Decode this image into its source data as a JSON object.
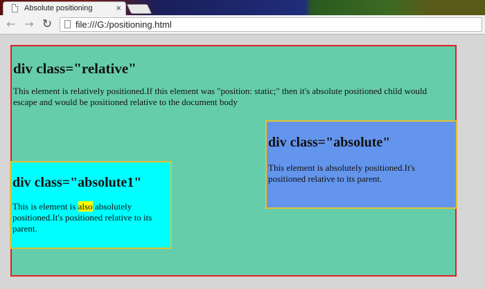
{
  "browser": {
    "tab_title": "Absolute positioning",
    "tab_close": "×",
    "url": "file:///G:/positioning.html",
    "back_icon": "back-arrow-icon",
    "forward_icon": "forward-arrow-icon",
    "reload_icon": "reload-icon"
  },
  "page": {
    "relative": {
      "heading": "div class=\"relative\"",
      "text": "This element is relatively positioned.If this element was \"position: static;\" then it's absolute positioned child would escape and would be positioned relative to the document body",
      "background": "#66cdaa",
      "border": "#e02020"
    },
    "absolute": {
      "heading": "div class=\"absolute\"",
      "text": "This element is absolutely positioned.It's positioned relative to its parent.",
      "background": "#6495ed",
      "border": "#e2c032"
    },
    "absolute1": {
      "heading": "div class=\"absolute1\"",
      "text_before": "This is element is ",
      "highlight": "also",
      "text_after": " absolutely positioned.It's positioned relative to its parent.",
      "background": "#00ffff",
      "highlight_color": "#ffff00"
    }
  }
}
